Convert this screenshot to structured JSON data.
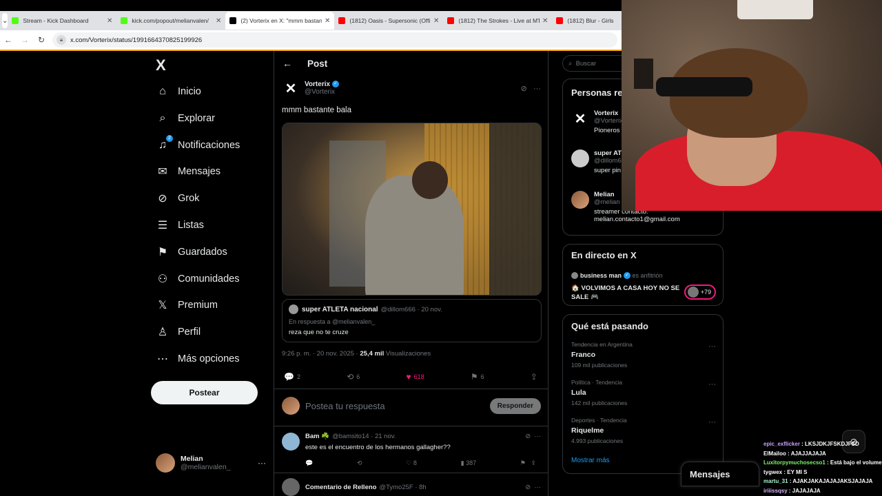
{
  "browser": {
    "tabs": [
      {
        "title": "Stream - Kick Dashboard",
        "color": "#53fc18"
      },
      {
        "title": "kick.com/popout/melianvalen/",
        "color": "#53fc18"
      },
      {
        "title": "(2) Vorterix en X: \"mmm bastan",
        "color": "#000000"
      },
      {
        "title": "(1812) Oasis - Supersonic (Offi",
        "color": "#ff0000"
      },
      {
        "title": "(1812) The Strokes - Live at MT",
        "color": "#ff0000"
      },
      {
        "title": "(1812) Blur - Girls",
        "color": "#ff0000"
      }
    ],
    "url": "x.com/Vorterix/status/1991664370825199926"
  },
  "nav": {
    "logo": "X",
    "items": [
      {
        "label": "Inicio",
        "icon": "home-icon",
        "glyph": "⌂"
      },
      {
        "label": "Explorar",
        "icon": "search-icon",
        "glyph": "⌕"
      },
      {
        "label": "Notificaciones",
        "icon": "bell-icon",
        "glyph": "♫",
        "badge": "2"
      },
      {
        "label": "Mensajes",
        "icon": "mail-icon",
        "glyph": "✉"
      },
      {
        "label": "Grok",
        "icon": "grok-icon",
        "glyph": "⊘"
      },
      {
        "label": "Listas",
        "icon": "list-icon",
        "glyph": "☰"
      },
      {
        "label": "Guardados",
        "icon": "bookmark-icon",
        "glyph": "⚑"
      },
      {
        "label": "Comunidades",
        "icon": "people-icon",
        "glyph": "⚇"
      },
      {
        "label": "Premium",
        "icon": "x-premium-icon",
        "glyph": "𝕏"
      },
      {
        "label": "Perfil",
        "icon": "person-icon",
        "glyph": "♙"
      },
      {
        "label": "Más opciones",
        "icon": "more-circle-icon",
        "glyph": "⋯"
      }
    ],
    "post_button": "Postear",
    "me": {
      "name": "Melian",
      "handle": "@melianvalen_"
    }
  },
  "post": {
    "header": "Post",
    "author": {
      "name": "Vorterix",
      "handle": "@Vorterix"
    },
    "text": "mmm bastante bala",
    "quote": {
      "name": "super ATLETA nacional",
      "handle": "@dillom666",
      "date": "· 20 nov.",
      "reply_to": "En respuesta a @melianvalen_",
      "text": "reza que no te cruze"
    },
    "meta_time": "9:26 p. m. · 20 nov. 2025 ·",
    "views_count": "25,4 mil",
    "views_label": "Visualizaciones",
    "stats": {
      "replies": "2",
      "reposts": "6",
      "likes": "618",
      "bookmarks": "6"
    },
    "reply_placeholder": "Postea tu respuesta",
    "reply_button": "Responder"
  },
  "replies": [
    {
      "name": "Bam ☘️",
      "handle": "@bamsito14 · 21 nov.",
      "text": "este es el encuentro de los hermanos gallagher??",
      "likes": "8",
      "views": "387"
    },
    {
      "name": "Comentario de Relleno",
      "handle": "@Tymo25F · 8h"
    }
  ],
  "sidebar": {
    "search_placeholder": "Buscar",
    "people_title": "Personas re",
    "people": [
      {
        "name": "Vorterix",
        "handle": "@Vorterix",
        "bio": "Pioneros"
      },
      {
        "name": "super AT",
        "handle": "@dillom6",
        "bio": "super pin"
      },
      {
        "name": "Melian",
        "handle": "@melian",
        "bio": "streamer contacto: melian.contacto1@gmail.com"
      }
    ],
    "live": {
      "title": "En directo en X",
      "host_name": "business man",
      "host_role": "es anfitrión",
      "stream_title": "🏠 VOLVIMOS A CASA HOY NO SE SALE 🎮",
      "count": "+79"
    },
    "trends_title": "Qué está pasando",
    "trends": [
      {
        "context": "Tendencia en Argentina",
        "name": "Franco",
        "posts": "109 mil publicaciones"
      },
      {
        "context": "Política · Tendencia",
        "name": "Lula",
        "posts": "142 mil publicaciones"
      },
      {
        "context": "Deportes · Tendencia",
        "name": "Riquelme",
        "posts": "4.993 publicaciones"
      }
    ],
    "show_more": "Mostrar más"
  },
  "messages_drawer": "Mensajes",
  "chat": [
    {
      "user": "epic_exflicker",
      "msg": "LKSJDKJFSKDJFSD"
    },
    {
      "user": "ElMailoo",
      "msg": "AJAJJAJAJA"
    },
    {
      "user": "Luxitorpymuchosecso1",
      "msg": "Está bajo el volumen"
    },
    {
      "user": "tygwex",
      "msg": "EY MI S"
    },
    {
      "user": "martu_31",
      "msg": "AJAKJAKAJAJAJAKSJAJAJA"
    },
    {
      "user": "iriiissqsy",
      "msg": "JAJAJAJA"
    }
  ]
}
